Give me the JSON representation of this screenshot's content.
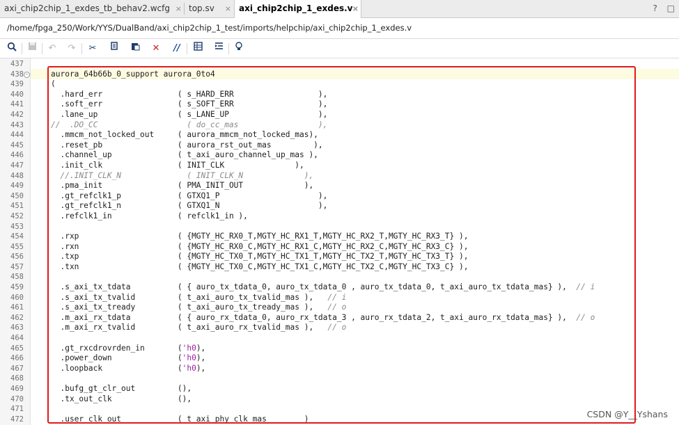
{
  "tabs": [
    {
      "label": "axi_chip2chip_1_exdes_tb_behav2.wcfg",
      "close": "×",
      "active": false
    },
    {
      "label": "top.sv",
      "close": "×",
      "active": false
    },
    {
      "label": "axi_chip2chip_1_exdes.v",
      "close": "×",
      "active": true
    }
  ],
  "tab_tools": {
    "help": "?",
    "restore": "□"
  },
  "file_path": "/home/fpga_250/Work/YYS/DualBand/axi_chip2chip_1_test/imports/helpchip/axi_chip2chip_1_exdes.v",
  "toolbar_icons": [
    "search-icon",
    "save-icon",
    "undo-icon",
    "redo-icon",
    "cut-icon",
    "copy-icon",
    "paste-icon",
    "delete-icon",
    "comment-icon",
    "block-select-icon",
    "indent-icon",
    "lightbulb-icon"
  ],
  "accent_colors": {
    "highlight_box": "#e01919",
    "keyword_value": "#9c1fa1",
    "comment": "#8a8a8a"
  },
  "code_lines": [
    {
      "n": "437",
      "segs": [
        {
          "t": "",
          "c": ""
        }
      ]
    },
    {
      "n": "438",
      "fold": true,
      "segs": [
        {
          "t": "aurora_64b66b_0_support aurora_0to4",
          "c": ""
        }
      ]
    },
    {
      "n": "439",
      "segs": [
        {
          "t": "(",
          "c": ""
        }
      ]
    },
    {
      "n": "440",
      "segs": [
        {
          "t": "  .hard_err                ( s_HARD_ERR                  ),",
          "c": ""
        }
      ]
    },
    {
      "n": "441",
      "segs": [
        {
          "t": "  .soft_err                ( s_SOFT_ERR                  ),",
          "c": ""
        }
      ]
    },
    {
      "n": "442",
      "segs": [
        {
          "t": "  .lane_up                 ( s_LANE_UP                   ),",
          "c": ""
        }
      ]
    },
    {
      "n": "443",
      "segs": [
        {
          "t": "//  .DO_CC                   ( do_cc_mas                 ),",
          "c": "cm"
        }
      ]
    },
    {
      "n": "444",
      "segs": [
        {
          "t": "  .mmcm_not_locked_out     ( aurora_mmcm_not_locked_mas),",
          "c": ""
        }
      ]
    },
    {
      "n": "445",
      "segs": [
        {
          "t": "  .reset_pb                ( aurora_rst_out_mas         ),",
          "c": ""
        }
      ]
    },
    {
      "n": "446",
      "segs": [
        {
          "t": "  .channel_up              ( t_axi_auro_channel_up_mas ),",
          "c": ""
        }
      ]
    },
    {
      "n": "447",
      "segs": [
        {
          "t": "  .init_clk                ( INIT_CLK               ),",
          "c": ""
        }
      ]
    },
    {
      "n": "448",
      "segs": [
        {
          "t": "  //.INIT_CLK_N              ( INIT_CLK_N             ),",
          "c": "cm"
        }
      ]
    },
    {
      "n": "449",
      "segs": [
        {
          "t": "  .pma_init                ( PMA_INIT_OUT             ),",
          "c": ""
        }
      ]
    },
    {
      "n": "450",
      "segs": [
        {
          "t": "  .gt_refclk1_p            ( GTXQ1_P                     ),",
          "c": ""
        }
      ]
    },
    {
      "n": "451",
      "segs": [
        {
          "t": "  .gt_refclk1_n            ( GTXQ1_N                     ),",
          "c": ""
        }
      ]
    },
    {
      "n": "452",
      "segs": [
        {
          "t": "  .refclk1_in              ( refclk1_in ),",
          "c": ""
        }
      ]
    },
    {
      "n": "453",
      "segs": [
        {
          "t": "",
          "c": ""
        }
      ]
    },
    {
      "n": "454",
      "segs": [
        {
          "t": "  .rxp                     ( {MGTY_HC_RX0_T,MGTY_HC_RX1_T,MGTY_HC_RX2_T,MGTY_HC_RX3_T} ),",
          "c": ""
        }
      ]
    },
    {
      "n": "455",
      "segs": [
        {
          "t": "  .rxn                     ( {MGTY_HC_RX0_C,MGTY_HC_RX1_C,MGTY_HC_RX2_C,MGTY_HC_RX3_C} ),",
          "c": ""
        }
      ]
    },
    {
      "n": "456",
      "segs": [
        {
          "t": "  .txp                     ( {MGTY_HC_TX0_T,MGTY_HC_TX1_T,MGTY_HC_TX2_T,MGTY_HC_TX3_T} ),",
          "c": ""
        }
      ]
    },
    {
      "n": "457",
      "segs": [
        {
          "t": "  .txn                     ( {MGTY_HC_TX0_C,MGTY_HC_TX1_C,MGTY_HC_TX2_C,MGTY_HC_TX3_C} ),",
          "c": ""
        }
      ]
    },
    {
      "n": "458",
      "segs": [
        {
          "t": "",
          "c": ""
        }
      ]
    },
    {
      "n": "459",
      "segs": [
        {
          "t": "  .s_axi_tx_tdata          ( { auro_tx_tdata_0, auro_tx_tdata_0 , auro_tx_tdata_0, t_axi_auro_tx_tdata_mas} ),  ",
          "c": ""
        },
        {
          "t": "// i",
          "c": "cm"
        }
      ]
    },
    {
      "n": "460",
      "segs": [
        {
          "t": "  .s_axi_tx_tvalid         ( t_axi_auro_tx_tvalid_mas ),   ",
          "c": ""
        },
        {
          "t": "// i",
          "c": "cm"
        }
      ]
    },
    {
      "n": "461",
      "segs": [
        {
          "t": "  .s_axi_tx_tready         ( t_axi_auro_tx_tready_mas ),   ",
          "c": ""
        },
        {
          "t": "// o",
          "c": "cm"
        }
      ]
    },
    {
      "n": "462",
      "segs": [
        {
          "t": "  .m_axi_rx_tdata          ( { auro_rx_tdata_0, auro_rx_tdata_3 , auro_rx_tdata_2, t_axi_auro_rx_tdata_mas} ),  ",
          "c": ""
        },
        {
          "t": "// o",
          "c": "cm"
        }
      ]
    },
    {
      "n": "463",
      "segs": [
        {
          "t": "  .m_axi_rx_tvalid         ( t_axi_auro_rx_tvalid_mas ),   ",
          "c": ""
        },
        {
          "t": "// o",
          "c": "cm"
        }
      ]
    },
    {
      "n": "464",
      "segs": [
        {
          "t": "",
          "c": ""
        }
      ]
    },
    {
      "n": "465",
      "segs": [
        {
          "t": "  .gt_rxcdrovrden_in       (",
          "c": ""
        },
        {
          "t": "'h0",
          "c": "cv"
        },
        {
          "t": "),",
          "c": ""
        }
      ]
    },
    {
      "n": "466",
      "segs": [
        {
          "t": "  .power_down              (",
          "c": ""
        },
        {
          "t": "'h0",
          "c": "cv"
        },
        {
          "t": "),",
          "c": ""
        }
      ]
    },
    {
      "n": "467",
      "segs": [
        {
          "t": "  .loopback                (",
          "c": ""
        },
        {
          "t": "'h0",
          "c": "cv"
        },
        {
          "t": "),",
          "c": ""
        }
      ]
    },
    {
      "n": "468",
      "segs": [
        {
          "t": "",
          "c": ""
        }
      ]
    },
    {
      "n": "469",
      "segs": [
        {
          "t": "  .bufg_gt_clr_out         (),",
          "c": ""
        }
      ]
    },
    {
      "n": "470",
      "segs": [
        {
          "t": "  .tx_out_clk              (),",
          "c": ""
        }
      ]
    },
    {
      "n": "471",
      "segs": [
        {
          "t": "",
          "c": ""
        }
      ]
    },
    {
      "n": "472",
      "segs": [
        {
          "t": "  .user_clk_out            ( t_axi_phy_clk_mas        )",
          "c": ""
        }
      ]
    }
  ],
  "watermark": "CSDN @Y__Yshans"
}
